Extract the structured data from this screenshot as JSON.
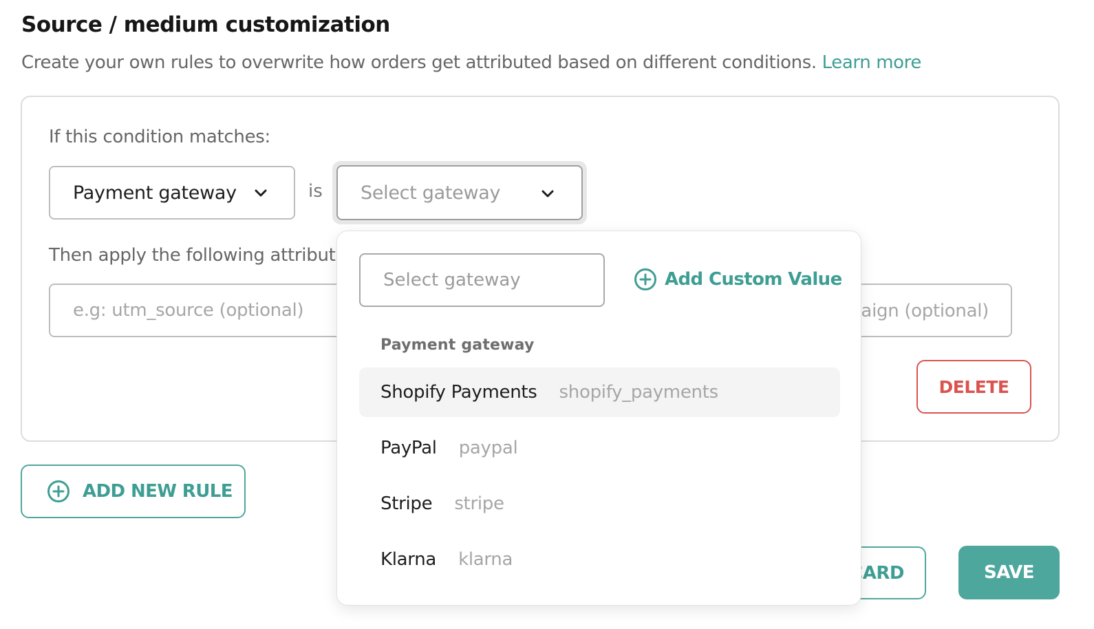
{
  "header": {
    "title": "Source / medium customization",
    "subtitle": "Create your own rules to overwrite how orders get attributed based on different conditions.",
    "learn_more": "Learn more"
  },
  "rule": {
    "condition_label": "If this condition matches:",
    "condition_type": "Payment gateway",
    "operator": "is",
    "value_placeholder": "Select gateway",
    "apply_label": "Then apply the following attribution:",
    "source_placeholder": "e.g: utm_source (optional)",
    "campaign_placeholder": "e.g: utm_campaign (optional)",
    "delete_label": "DELETE"
  },
  "actions": {
    "add_rule_label": "ADD NEW RULE",
    "discard_label": "DISCARD",
    "save_label": "SAVE"
  },
  "dropdown": {
    "search_placeholder": "Select gateway",
    "add_custom_label": "Add Custom Value",
    "group_label": "Payment gateway",
    "options": [
      {
        "name": "Shopify Payments",
        "code": "shopify_payments",
        "highlighted": true
      },
      {
        "name": "PayPal",
        "code": "paypal"
      },
      {
        "name": "Stripe",
        "code": "stripe"
      },
      {
        "name": "Klarna",
        "code": "klarna"
      }
    ]
  },
  "colors": {
    "accent": "#4ea79c",
    "accent_text": "#3e9e93",
    "danger": "#d9534f"
  },
  "icons": [
    "chevron-down-icon",
    "plus-circle-icon"
  ]
}
